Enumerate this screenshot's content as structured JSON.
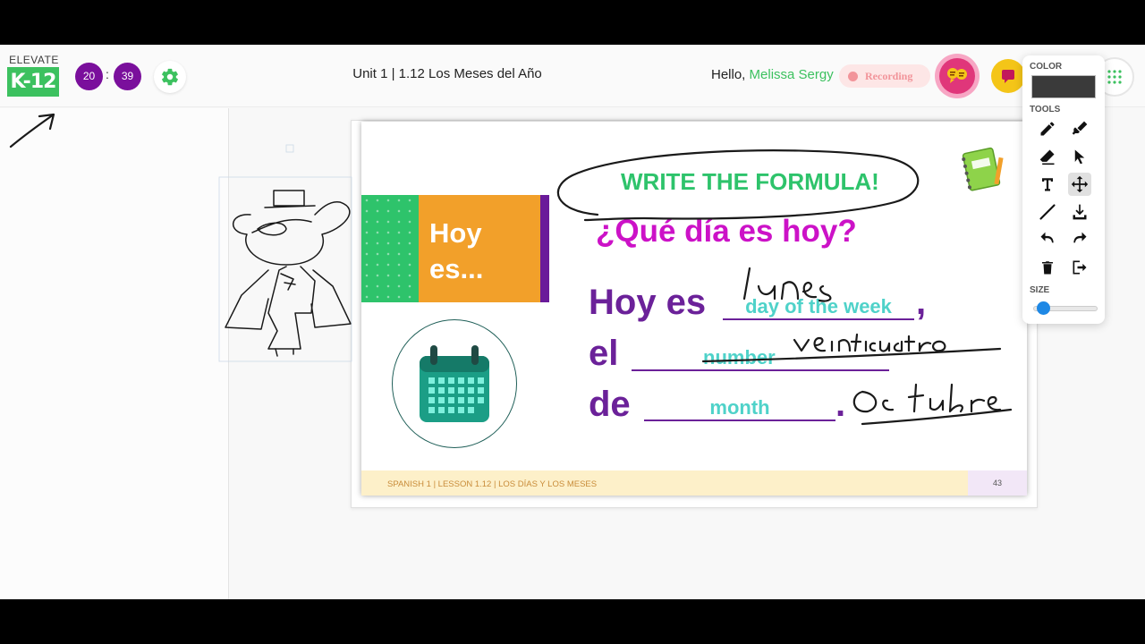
{
  "header": {
    "logo_top": "ELEVATE",
    "logo_main": "K-12",
    "timer": {
      "minutes": "20",
      "separator": ":",
      "seconds": "39"
    },
    "title": "Unit 1 | 1.12 Los Meses del Año",
    "greeting": "Hello,",
    "user_name": "Melissa Sergy",
    "recording_label": "Recording"
  },
  "toolbox": {
    "color_label": "COLOR",
    "current_color": "#3a3a3a",
    "tools_label": "TOOLS",
    "size_label": "SIZE",
    "size_value": 0.1,
    "tools": [
      "pencil-icon",
      "marker-icon",
      "eraser-icon",
      "pointer-icon",
      "text-icon",
      "move-icon",
      "line-icon",
      "download-icon",
      "undo-icon",
      "redo-icon",
      "trash-icon",
      "exit-icon"
    ],
    "active_tool": "move-icon"
  },
  "slide": {
    "heading": "WRITE THE FORMULA!",
    "hoy_line1": "Hoy",
    "hoy_line2": "es...",
    "question": "¿Qué día es hoy?",
    "line1_text": "Hoy es",
    "line1_blank": "day of the week",
    "line1_end": ",",
    "line2_text": "el",
    "line2_blank": "number",
    "line3_text": "de",
    "line3_blank": "month",
    "line3_end": ".",
    "footer": "SPANISH 1 | LESSON 1.12 | LOS DÍAS Y LOS MESES",
    "page_number": "43"
  },
  "colors": {
    "brand_green": "#3cc15f",
    "timer_purple": "#7a0f9c",
    "heading_green": "#2ec36b",
    "question_magenta": "#cc12c7",
    "formula_purple": "#6b2199",
    "blank_teal": "#4fd2c9",
    "orange": "#f2a02a",
    "recording_pink": "#f2949a"
  }
}
